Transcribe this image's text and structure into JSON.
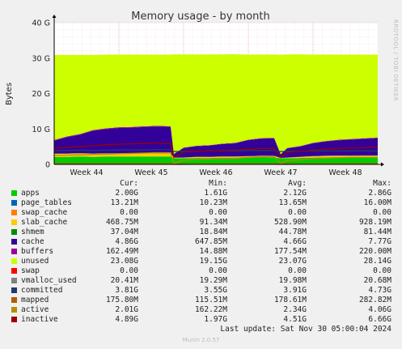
{
  "chart_data": {
    "type": "area",
    "title": "Memory usage - by month",
    "ylabel": "Bytes",
    "xlabel": "",
    "ylim": [
      0,
      40
    ],
    "y_unit": "G",
    "yticks": [
      "0",
      "10 G",
      "20 G",
      "30 G",
      "40 G"
    ],
    "xticks": [
      "Week 44",
      "Week 45",
      "Week 46",
      "Week 47",
      "Week 48"
    ],
    "grid": true,
    "side_label": "RRDTOOL / TOBI OETIKER",
    "x_weeks": [
      44.0,
      44.2,
      44.4,
      44.6,
      44.8,
      45.0,
      45.2,
      45.4,
      45.6,
      45.8,
      45.85,
      46.0,
      46.2,
      46.4,
      46.6,
      46.8,
      47.0,
      47.2,
      47.4,
      47.5,
      47.6,
      47.8,
      48.0,
      48.2,
      48.4,
      48.6,
      48.8,
      49.0
    ],
    "series": [
      {
        "name": "apps",
        "color": "#00cc00",
        "values": [
          2.1,
          2.1,
          2.2,
          2.1,
          2.2,
          2.2,
          2.2,
          2.2,
          2.2,
          2.2,
          1.7,
          1.7,
          1.8,
          1.8,
          1.9,
          1.9,
          1.9,
          2.0,
          2.0,
          1.7,
          1.7,
          1.8,
          1.9,
          2.0,
          2.0,
          2.0,
          2.0,
          2.0
        ]
      },
      {
        "name": "page_tables",
        "color": "#0066b3",
        "values": [
          0.015,
          0.015,
          0.015,
          0.015,
          0.015,
          0.015,
          0.015,
          0.015,
          0.015,
          0.015,
          0.012,
          0.012,
          0.013,
          0.013,
          0.013,
          0.013,
          0.013,
          0.014,
          0.014,
          0.012,
          0.012,
          0.013,
          0.013,
          0.013,
          0.013,
          0.013,
          0.013,
          0.013
        ]
      },
      {
        "name": "swap_cache",
        "color": "#ff8000",
        "values": [
          0,
          0,
          0,
          0,
          0,
          0,
          0,
          0,
          0,
          0,
          0,
          0,
          0,
          0,
          0,
          0,
          0,
          0,
          0,
          0,
          0,
          0,
          0,
          0,
          0,
          0,
          0,
          0
        ]
      },
      {
        "name": "slab_cache",
        "color": "#ffcc00",
        "values": [
          0.9,
          0.9,
          0.9,
          0.9,
          0.9,
          0.9,
          0.9,
          0.9,
          0.9,
          0.9,
          0.2,
          0.2,
          0.3,
          0.3,
          0.3,
          0.3,
          0.4,
          0.4,
          0.4,
          0.1,
          0.2,
          0.3,
          0.4,
          0.4,
          0.45,
          0.45,
          0.47,
          0.47
        ]
      },
      {
        "name": "shmem",
        "color": "#330099",
        "values": [
          0.06,
          0.06,
          0.06,
          0.06,
          0.06,
          0.06,
          0.06,
          0.06,
          0.06,
          0.06,
          0.02,
          0.02,
          0.03,
          0.03,
          0.03,
          0.03,
          0.03,
          0.03,
          0.03,
          0.02,
          0.02,
          0.03,
          0.03,
          0.03,
          0.04,
          0.04,
          0.04,
          0.04
        ]
      },
      {
        "name": "cache",
        "color": "#330099",
        "values": [
          3.6,
          4.6,
          5.2,
          6.4,
          6.8,
          7.1,
          7.2,
          7.4,
          7.5,
          7.4,
          1.0,
          2.7,
          3.0,
          3.2,
          3.5,
          3.7,
          4.5,
          4.8,
          4.9,
          1.0,
          2.6,
          2.9,
          3.6,
          4.0,
          4.3,
          4.5,
          4.7,
          4.9
        ]
      },
      {
        "name": "buffers",
        "color": "#990099",
        "values": [
          0.2,
          0.2,
          0.2,
          0.2,
          0.2,
          0.2,
          0.2,
          0.2,
          0.2,
          0.2,
          0.02,
          0.1,
          0.1,
          0.1,
          0.12,
          0.13,
          0.14,
          0.15,
          0.15,
          0.02,
          0.1,
          0.12,
          0.14,
          0.15,
          0.16,
          0.16,
          0.16,
          0.16
        ]
      },
      {
        "name": "unused",
        "color": "#ccff00",
        "values": [
          24.0,
          23.0,
          22.3,
          21.2,
          20.8,
          20.5,
          20.4,
          20.2,
          20.1,
          20.2,
          28.1,
          26.3,
          25.8,
          25.6,
          25.2,
          25.0,
          24.0,
          23.6,
          23.5,
          28.1,
          26.4,
          25.9,
          24.9,
          24.4,
          24.0,
          23.8,
          23.6,
          23.4
        ]
      },
      {
        "name": "swap",
        "color": "#ff0000",
        "values": [
          0,
          0,
          0,
          0,
          0,
          0,
          0,
          0,
          0,
          0,
          0,
          0,
          0,
          0,
          0,
          0,
          0,
          0,
          0,
          0,
          0,
          0,
          0,
          0,
          0,
          0,
          0,
          0
        ]
      },
      {
        "name": "vmalloc_used",
        "color": "#808080",
        "values": [
          0.02,
          0.02,
          0.02,
          0.02,
          0.02,
          0.02,
          0.02,
          0.02,
          0.02,
          0.02,
          0.019,
          0.019,
          0.02,
          0.02,
          0.02,
          0.02,
          0.02,
          0.02,
          0.02,
          0.019,
          0.019,
          0.02,
          0.02,
          0.02,
          0.02,
          0.02,
          0.02,
          0.02
        ]
      },
      {
        "name": "committed",
        "color": "#1f3b6e",
        "values": [
          3.9,
          3.9,
          4.0,
          3.9,
          4.0,
          4.1,
          4.1,
          4.1,
          4.2,
          4.1,
          3.6,
          3.7,
          3.7,
          3.8,
          3.8,
          3.8,
          3.9,
          3.9,
          3.9,
          3.6,
          3.7,
          3.7,
          3.8,
          3.8,
          3.8,
          3.8,
          3.8,
          3.8
        ]
      },
      {
        "name": "mapped",
        "color": "#b35a00",
        "values": [
          0.2,
          0.2,
          0.2,
          0.2,
          0.2,
          0.2,
          0.2,
          0.2,
          0.2,
          0.2,
          0.12,
          0.13,
          0.14,
          0.15,
          0.16,
          0.16,
          0.17,
          0.17,
          0.18,
          0.12,
          0.14,
          0.15,
          0.16,
          0.17,
          0.17,
          0.17,
          0.18,
          0.18
        ]
      },
      {
        "name": "active",
        "color": "#b38f00",
        "values": [
          2.5,
          2.6,
          2.7,
          2.8,
          2.9,
          3.0,
          3.1,
          3.2,
          3.3,
          3.3,
          0.2,
          1.2,
          1.4,
          1.5,
          1.6,
          1.7,
          2.0,
          2.1,
          2.2,
          0.2,
          1.1,
          1.3,
          1.6,
          1.8,
          1.9,
          2.0,
          2.0,
          2.0
        ]
      },
      {
        "name": "inactive",
        "color": "#990000",
        "values": [
          4.5,
          4.8,
          5.0,
          5.3,
          5.5,
          5.7,
          5.8,
          5.9,
          6.0,
          5.9,
          2.0,
          3.5,
          3.7,
          3.8,
          3.9,
          4.0,
          4.3,
          4.5,
          4.5,
          2.0,
          3.4,
          3.7,
          4.0,
          4.3,
          4.5,
          4.6,
          4.7,
          4.9
        ]
      }
    ],
    "stacked_series": [
      "apps",
      "page_tables",
      "swap_cache",
      "slab_cache",
      "shmem",
      "cache",
      "buffers",
      "unused",
      "swap"
    ],
    "line_series": [
      "vmalloc_used",
      "committed",
      "mapped",
      "active",
      "inactive"
    ]
  },
  "legend": {
    "headers": {
      "cur": "Cur:",
      "min": "Min:",
      "avg": "Avg:",
      "max": "Max:"
    },
    "rows": [
      {
        "name": "apps",
        "color": "#00cc00",
        "cur": "2.00G",
        "min": "1.61G",
        "avg": "2.12G",
        "max": "2.86G"
      },
      {
        "name": "page_tables",
        "color": "#0066b3",
        "cur": "13.21M",
        "min": "10.23M",
        "avg": "13.65M",
        "max": "16.00M"
      },
      {
        "name": "swap_cache",
        "color": "#ff8000",
        "cur": "0.00",
        "min": "0.00",
        "avg": "0.00",
        "max": "0.00"
      },
      {
        "name": "slab_cache",
        "color": "#ffcc00",
        "cur": "468.75M",
        "min": "91.34M",
        "avg": "528.90M",
        "max": "928.19M"
      },
      {
        "name": "shmem",
        "color": "#008f00",
        "cur": "37.04M",
        "min": "18.84M",
        "avg": "44.78M",
        "max": "81.44M"
      },
      {
        "name": "cache",
        "color": "#330099",
        "cur": "4.86G",
        "min": "647.85M",
        "avg": "4.66G",
        "max": "7.77G"
      },
      {
        "name": "buffers",
        "color": "#990099",
        "cur": "162.49M",
        "min": "14.88M",
        "avg": "177.54M",
        "max": "220.00M"
      },
      {
        "name": "unused",
        "color": "#ccff00",
        "cur": "23.08G",
        "min": "19.15G",
        "avg": "23.07G",
        "max": "28.14G"
      },
      {
        "name": "swap",
        "color": "#ff0000",
        "cur": "0.00",
        "min": "0.00",
        "avg": "0.00",
        "max": "0.00"
      },
      {
        "name": "vmalloc_used",
        "color": "#808080",
        "cur": "20.41M",
        "min": "19.29M",
        "avg": "19.98M",
        "max": "20.68M"
      },
      {
        "name": "committed",
        "color": "#1f3b6e",
        "cur": "3.81G",
        "min": "3.55G",
        "avg": "3.91G",
        "max": "4.73G"
      },
      {
        "name": "mapped",
        "color": "#b35a00",
        "cur": "175.80M",
        "min": "115.51M",
        "avg": "178.61M",
        "max": "282.82M"
      },
      {
        "name": "active",
        "color": "#b38f00",
        "cur": "2.01G",
        "min": "162.22M",
        "avg": "2.34G",
        "max": "4.06G"
      },
      {
        "name": "inactive",
        "color": "#990000",
        "cur": "4.89G",
        "min": "1.97G",
        "avg": "4.51G",
        "max": "6.66G"
      }
    ]
  },
  "footer": {
    "last_update": "Last update: Sat Nov 30 05:00:04 2024",
    "munin": "Munin 2.0.57"
  }
}
